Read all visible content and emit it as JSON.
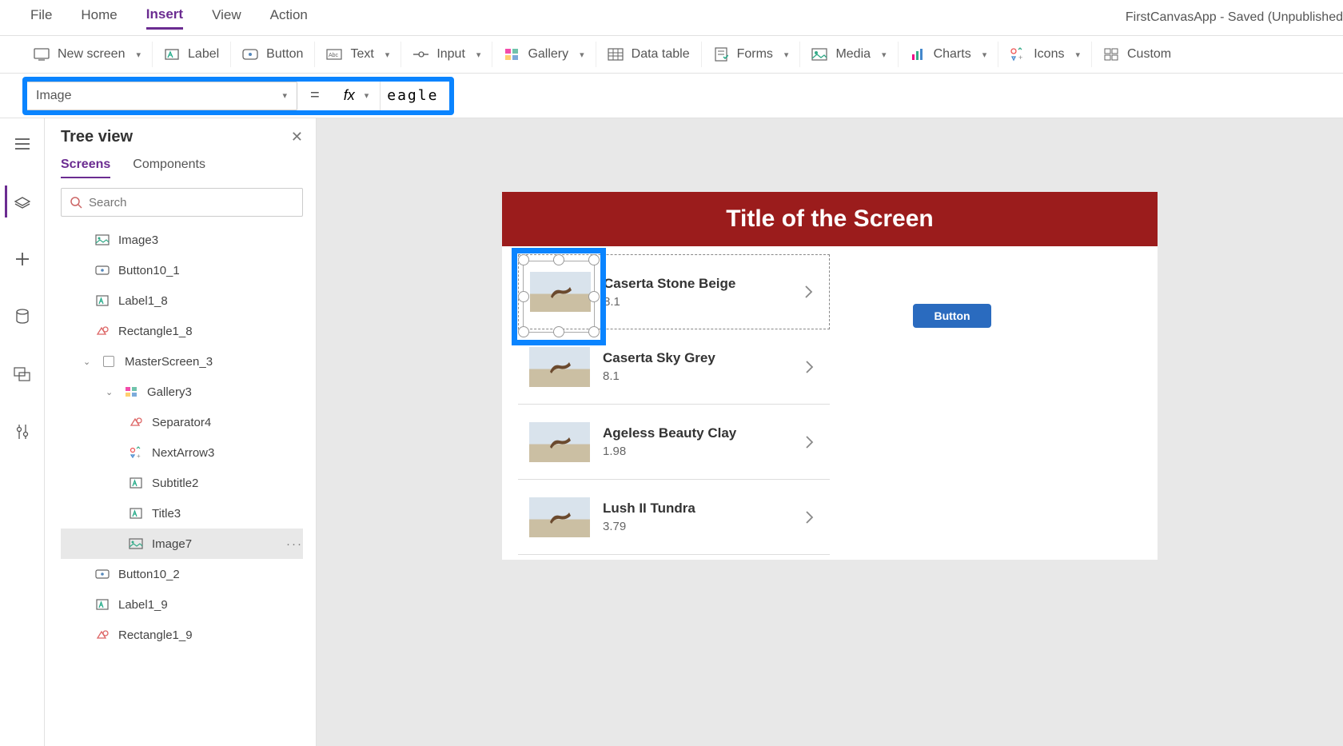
{
  "app_title": "FirstCanvasApp - Saved (Unpublished",
  "menus": [
    "File",
    "Home",
    "Insert",
    "View",
    "Action"
  ],
  "active_menu": "Insert",
  "ribbon": {
    "new_screen": "New screen",
    "label": "Label",
    "button": "Button",
    "text": "Text",
    "input": "Input",
    "gallery": "Gallery",
    "data_table": "Data table",
    "forms": "Forms",
    "media": "Media",
    "charts": "Charts",
    "icons": "Icons",
    "custom": "Custom"
  },
  "formula": {
    "property": "Image",
    "equals": "=",
    "fx": "fx",
    "value": "eagle"
  },
  "tree": {
    "title": "Tree view",
    "tabs": {
      "screens": "Screens",
      "components": "Components"
    },
    "search_placeholder": "Search",
    "items": [
      {
        "label": "Image3",
        "icon": "image",
        "indent": 1
      },
      {
        "label": "Button10_1",
        "icon": "button",
        "indent": 1
      },
      {
        "label": "Label1_8",
        "icon": "label",
        "indent": 1
      },
      {
        "label": "Rectangle1_8",
        "icon": "shape",
        "indent": 1
      },
      {
        "label": "MasterScreen_3",
        "icon": "screen",
        "indent": 0,
        "expandable": true
      },
      {
        "label": "Gallery3",
        "icon": "gallery",
        "indent": 2,
        "expandable": true
      },
      {
        "label": "Separator4",
        "icon": "shape",
        "indent": 4
      },
      {
        "label": "NextArrow3",
        "icon": "icons",
        "indent": 4
      },
      {
        "label": "Subtitle2",
        "icon": "label",
        "indent": 4
      },
      {
        "label": "Title3",
        "icon": "label",
        "indent": 4
      },
      {
        "label": "Image7",
        "icon": "image",
        "indent": 4,
        "selected": true
      },
      {
        "label": "Button10_2",
        "icon": "button",
        "indent": 1
      },
      {
        "label": "Label1_9",
        "icon": "label",
        "indent": 1
      },
      {
        "label": "Rectangle1_9",
        "icon": "shape",
        "indent": 1
      }
    ]
  },
  "canvas": {
    "header": "Title of the Screen",
    "button": "Button",
    "gallery": [
      {
        "title": "Caserta Stone Beige",
        "sub": "8.1"
      },
      {
        "title": "Caserta Sky Grey",
        "sub": "8.1"
      },
      {
        "title": "Ageless Beauty Clay",
        "sub": "1.98"
      },
      {
        "title": "Lush II Tundra",
        "sub": "3.79"
      }
    ]
  }
}
